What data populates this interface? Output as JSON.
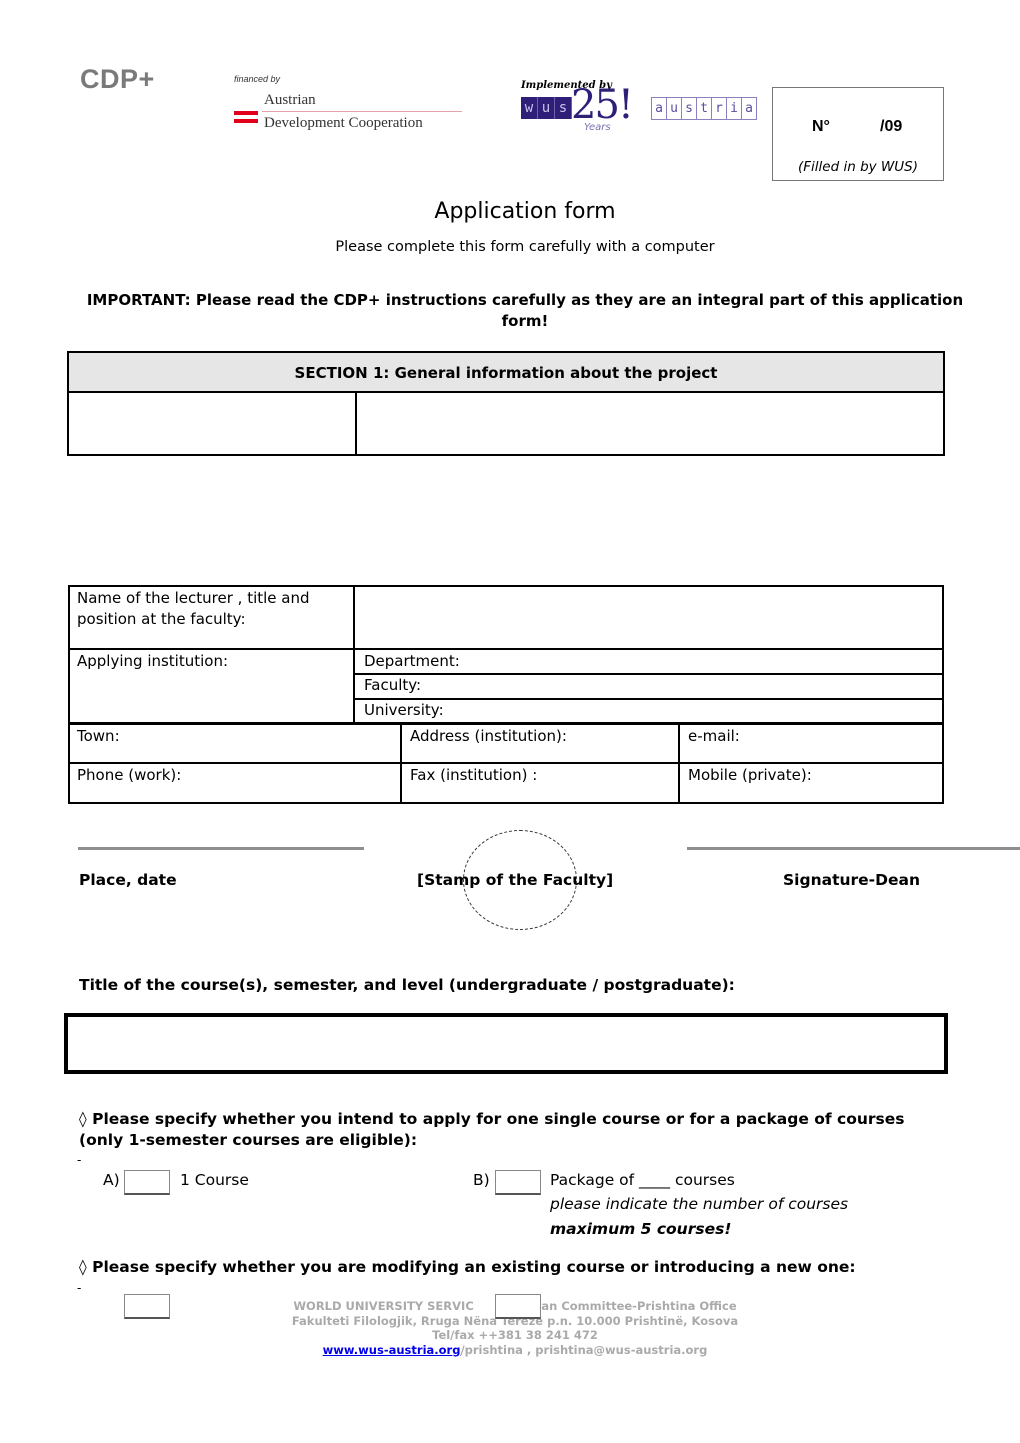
{
  "header": {
    "program": "CDP+",
    "financed_by": "financed by",
    "funder_line1": "Austrian",
    "funder_line2": "Development Cooperation",
    "implemented_by": "Implemented by",
    "implementer_logo": {
      "wus_letters": [
        "w",
        "u",
        "s"
      ],
      "anniversary": "25!",
      "years": "Years",
      "austria_letters": [
        "a",
        "u",
        "s",
        "t",
        "r",
        "i",
        "a"
      ]
    },
    "number_box": {
      "label": "N°",
      "value": "/09",
      "note": "(Filled in by WUS)"
    }
  },
  "title": "Application form",
  "subtitle": "Please complete this form carefully with a computer",
  "important": "IMPORTANT: Please read the CDP+ instructions carefully as they are an integral part of this application form!",
  "section1": {
    "heading": "SECTION 1: General information about the project",
    "left_value": "",
    "right_value": ""
  },
  "lecturer_table": {
    "name_label": "Name of the lecturer , title and position at the faculty:",
    "name_value": "",
    "institution_label": "Applying institution:",
    "department_label": "Department:",
    "faculty_label": "Faculty:",
    "university_label": "University:",
    "town_label": "Town:",
    "address_label": "Address (institution):",
    "email_label": "e-mail:",
    "phone_label": "Phone (work):",
    "fax_label": "Fax (institution) :",
    "mobile_label": "Mobile (private):"
  },
  "signatures": {
    "place_date": "Place, date",
    "stamp": "[Stamp of the Faculty]",
    "signature": "Signature-Dean"
  },
  "course": {
    "label": "Title of the course(s), semester, and level (undergraduate / postgraduate):",
    "value": ""
  },
  "question1": {
    "bullet": "◊",
    "text": "Please specify whether you intend to apply for one single course or for a package of courses (only 1-semester courses are eligible):",
    "dash": "-",
    "option_a_prefix": "A)",
    "option_a_label": "1 Course",
    "option_a_checked": false,
    "option_b_prefix": "B)",
    "option_b_label": "Package of ____ courses",
    "option_b_hint": "please indicate the number of courses",
    "option_b_max": "maximum 5 courses!",
    "option_b_checked": false
  },
  "question2": {
    "bullet": "◊",
    "text": "Please specify whether you are modifying an existing course or introducing a new one:",
    "dash": "-",
    "option_1_checked": false,
    "option_2_checked": false
  },
  "footer": {
    "line1_left": "WORLD UNIVERSITY SERVIC",
    "line1_right": "rian Committee-Prishtina Office",
    "line2": "Fakulteti Filologjik, Rruga Nëna Terezë p.n. 10.000 Prishtinë, Kosova",
    "line3": "Tel/fax ++381 38 241 472",
    "link": "www.wus-austria.org",
    "line4_rest": "/prishtina , prishtina@wus-austria.org"
  }
}
